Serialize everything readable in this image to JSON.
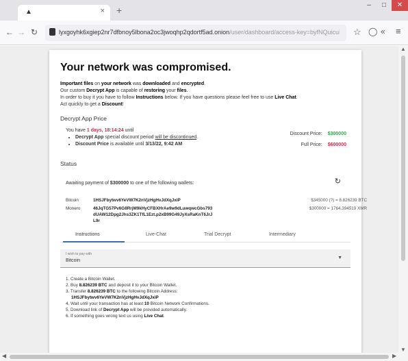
{
  "browser": {
    "tab_favicon": "wolf-icon",
    "tab_close": "×",
    "new_tab": "+",
    "url_main": "lyxgoyhk6xgiep2nr7dfbnoy5lbona2oc3jwoqhp2qdortf5ad.onion",
    "url_path": "/user/dashboard/access-key=byfNQuicuN..."
  },
  "page": {
    "heading": "Your network was compromised.",
    "intro": {
      "l1_a": "Important files",
      "l1_b": " on ",
      "l1_c": "your network",
      "l1_d": " was ",
      "l1_e": "downloaded",
      "l1_f": " and ",
      "l1_g": "encrypted",
      "l1_h": ".",
      "l2_a": "Our custom ",
      "l2_b": "Decrypt App",
      "l2_c": " is capable of ",
      "l2_d": "restoring",
      "l2_e": " your ",
      "l2_f": "files",
      "l2_g": ".",
      "l3_a": "In order to buy it you have to follow ",
      "l3_b": "Instructions",
      "l3_c": " below. If you have questions please feel free to use ",
      "l3_d": "Live Chat",
      "l3_e": ".",
      "l4_a": "Act quickly to get a ",
      "l4_b": "Discount",
      "l4_c": "!"
    },
    "price_section": {
      "title": "Decrypt App Price",
      "have_a": "You have ",
      "have_time": "1 days, 18:14:24",
      "have_b": " until",
      "b1_a": "Decrypt App",
      "b1_b": " special discount period ",
      "b1_c": "will be discontinued",
      "b1_d": ".",
      "b2_a": "Discount Price",
      "b2_b": " is available until ",
      "b2_c": "3/13/22, 9:42 AM",
      "discount_label": "Discount Price:",
      "discount_value": "$300000",
      "full_label": "Full Price:",
      "full_value": "$600000"
    },
    "status": {
      "title": "Status",
      "await_a": "Awaiting payment of ",
      "await_amount": "$300000",
      "await_b": " to one of the following wallets:",
      "btc_name": "Bitcoin",
      "btc_addr": "1HSJFbytwv6YeVW7K2nVjzHgHvJdXqJxiP",
      "btc_amt": "$345000 (?) = 8.826239 BTC",
      "xmr_name": "Monero",
      "xmr_addr": "46JqTG57Pv6G8RrjM9kHyCFBXHrAe9w9dLuwqwcGbs793dUAW12Dpg2Jhs3ZK1TfL1Ezt.p2xB99G49JyXsRaKnT6JrJL9r",
      "xmr_amt": "$300000 = 1764.394519 XMR"
    },
    "tabs": [
      "Instructions",
      "Live-Chat",
      "Trial Decrypt",
      "Intermediary"
    ],
    "select": {
      "label": "I wish to pay with",
      "value": "Bitcoin"
    },
    "steps": {
      "s1": "1. Create a Bitcoin Wallet.",
      "s2_a": "2. Buy ",
      "s2_b": "8.826239 BTC",
      "s2_c": " and deposit it to your Bitcoin Wallet.",
      "s3_a": "3. Transfer ",
      "s3_b": "8.826239 BTC",
      "s3_c": " to the following Bitcoin Address:",
      "s3_addr": "1HSJFbytwv6YeVW7K2nVjzHgHvJdXqJxiP",
      "s4_a": "4. Wait until your transaction has at least ",
      "s4_b": "10",
      "s4_c": " Bitcoin Network Confirmations.",
      "s5_a": "5. Download link of ",
      "s5_b": "Decrypt App",
      "s5_c": " will be provided automatically.",
      "s6_a": "6. If something goes wrong text us using ",
      "s6_b": "Live Chat",
      "s6_c": "."
    }
  }
}
